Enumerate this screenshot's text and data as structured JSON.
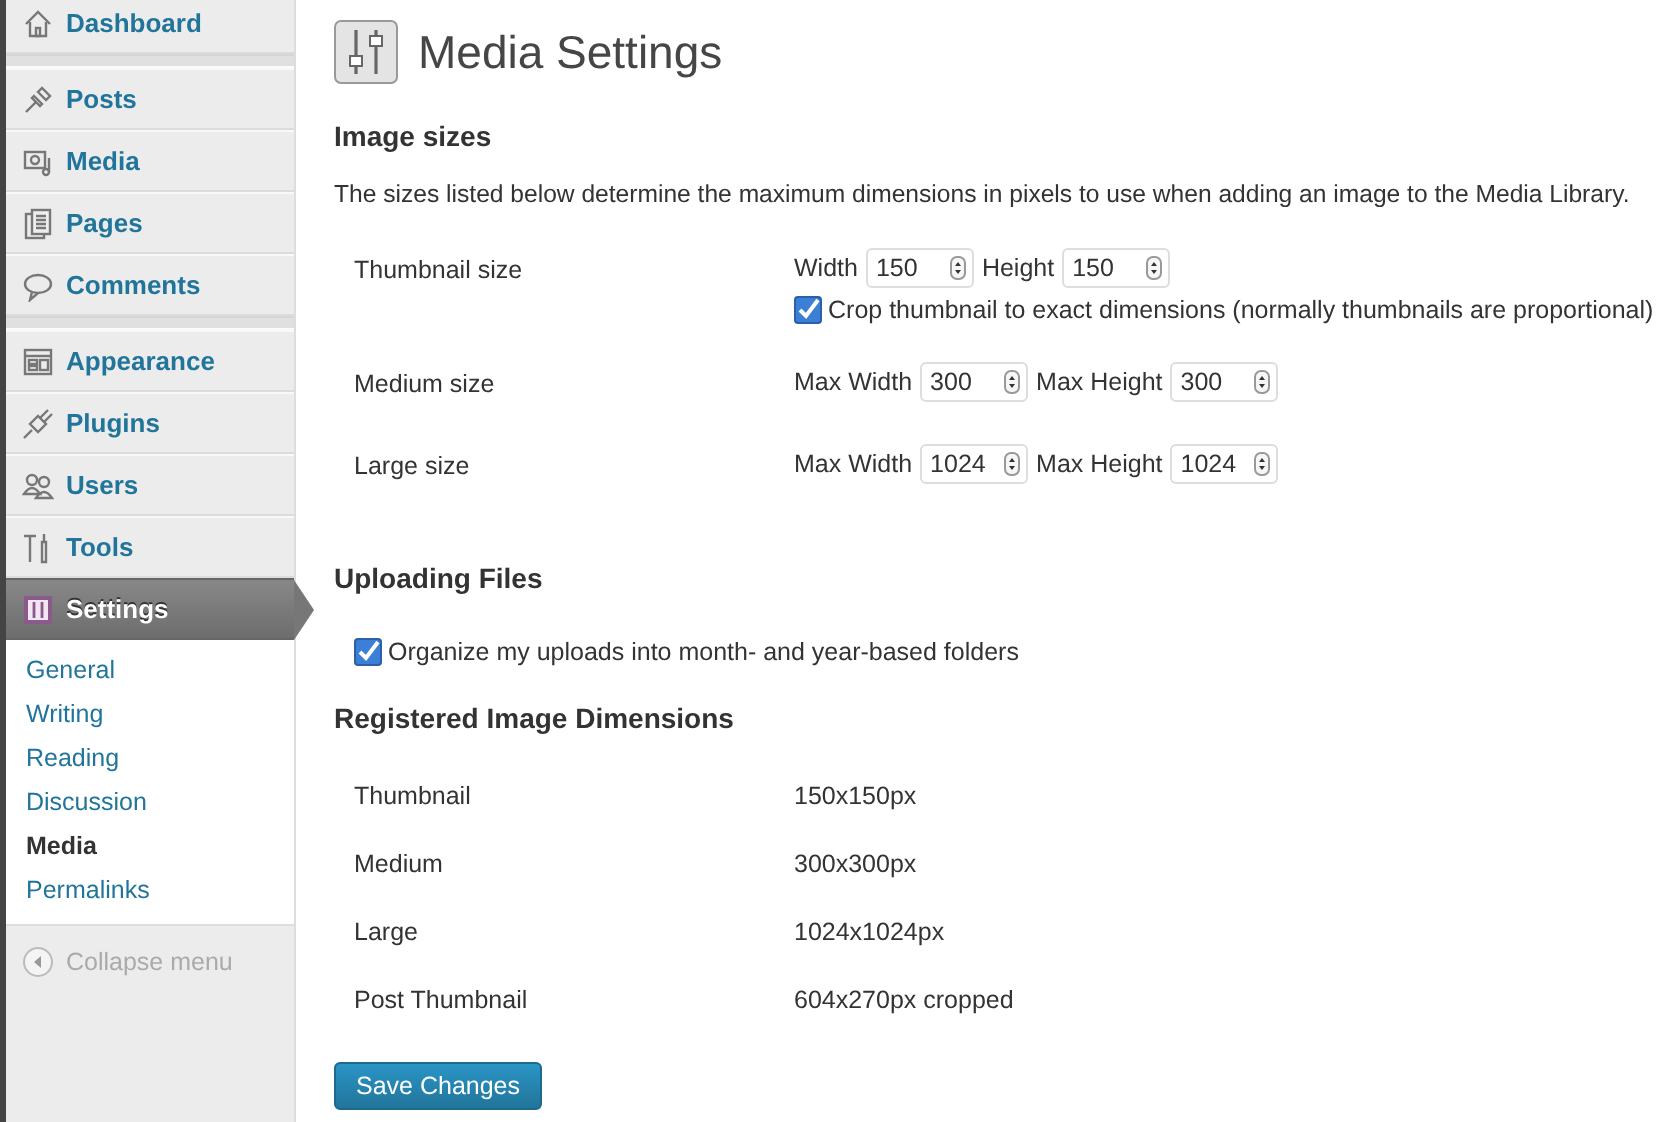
{
  "sidebar": {
    "menu": [
      {
        "label": "Dashboard",
        "selected": false,
        "separator_after": true
      },
      {
        "label": "Posts",
        "selected": false,
        "separator_after": false
      },
      {
        "label": "Media",
        "selected": false,
        "separator_after": false
      },
      {
        "label": "Pages",
        "selected": false,
        "separator_after": false
      },
      {
        "label": "Comments",
        "selected": false,
        "separator_after": true
      },
      {
        "label": "Appearance",
        "selected": false,
        "separator_after": false
      },
      {
        "label": "Plugins",
        "selected": false,
        "separator_after": false
      },
      {
        "label": "Users",
        "selected": false,
        "separator_after": false
      },
      {
        "label": "Tools",
        "selected": false,
        "separator_after": false
      },
      {
        "label": "Settings",
        "selected": true,
        "separator_after": false
      }
    ],
    "submenu": [
      {
        "label": "General",
        "selected": false
      },
      {
        "label": "Writing",
        "selected": false
      },
      {
        "label": "Reading",
        "selected": false
      },
      {
        "label": "Discussion",
        "selected": false
      },
      {
        "label": "Media",
        "selected": true
      },
      {
        "label": "Permalinks",
        "selected": false
      }
    ],
    "collapse": "Collapse menu"
  },
  "title": "Media Settings",
  "image_sizes": {
    "heading": "Image sizes",
    "description": "The sizes listed below determine the maximum dimensions in pixels to use when adding an image to the Media Library.",
    "rows": [
      {
        "label": "Thumbnail size",
        "fields": [
          {
            "label": "Width",
            "value": "150"
          },
          {
            "label": "Height",
            "value": "150"
          }
        ],
        "checkbox": {
          "label": "Crop thumbnail to exact dimensions (normally thumbnails are proportional)",
          "checked": true
        }
      },
      {
        "label": "Medium size",
        "fields": [
          {
            "label": "Max Width",
            "value": "300"
          },
          {
            "label": "Max Height",
            "value": "300"
          }
        ]
      },
      {
        "label": "Large size",
        "fields": [
          {
            "label": "Max Width",
            "value": "1024"
          },
          {
            "label": "Max Height",
            "value": "1024"
          }
        ]
      }
    ]
  },
  "uploading": {
    "heading": "Uploading Files",
    "checkbox": {
      "label": "Organize my uploads into month- and year-based folders",
      "checked": true
    }
  },
  "registered": {
    "heading": "Registered Image Dimensions",
    "rows": [
      {
        "name": "Thumbnail",
        "size": "150x150px"
      },
      {
        "name": "Medium",
        "size": "300x300px"
      },
      {
        "name": "Large",
        "size": "1024x1024px"
      },
      {
        "name": "Post Thumbnail",
        "size": "604x270px cropped"
      }
    ]
  },
  "save_button": "Save Changes"
}
